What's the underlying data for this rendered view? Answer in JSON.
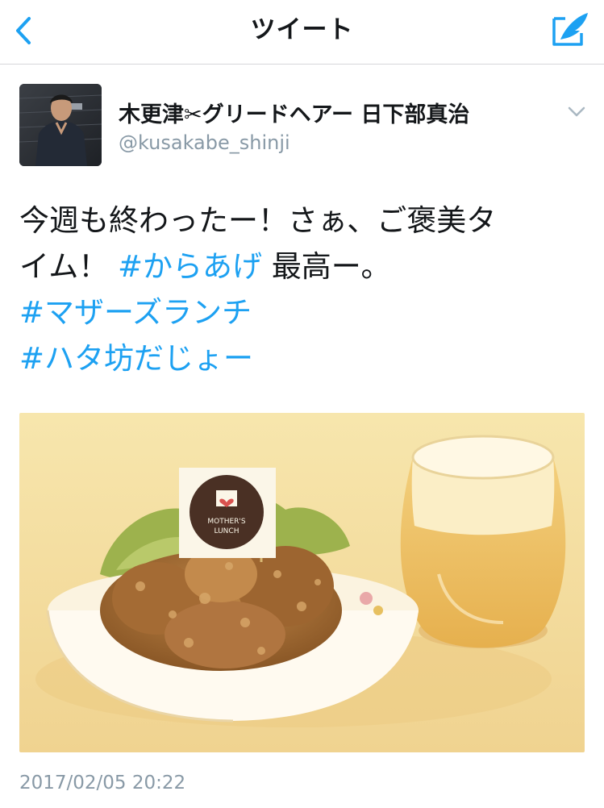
{
  "navbar": {
    "title": "ツイート",
    "back_icon": "chevron-left-icon",
    "compose_icon": "compose-tweet-icon"
  },
  "tweet": {
    "author": {
      "display_name": "木更津✂グリードヘアー 日下部真治",
      "handle": "@kusakabe_shinji"
    },
    "text_line1": "今週も終わったー！さぁ、ご褒美タ",
    "text_line2_prefix": "イム！",
    "hashtag_1": "#からあげ",
    "text_line2_suffix": "最高ー。",
    "hashtag_2": "#マザーズランチ",
    "hashtag_3": "#ハタ坊だじょー",
    "media": {
      "flag_line1": "MOTHER'S",
      "flag_line2": "LUNCH"
    },
    "timestamp": "2017/02/05 20:22"
  },
  "colors": {
    "link": "#1da1f2",
    "text": "#14171a",
    "secondary": "#8899a6",
    "divider": "#d6d6da"
  }
}
